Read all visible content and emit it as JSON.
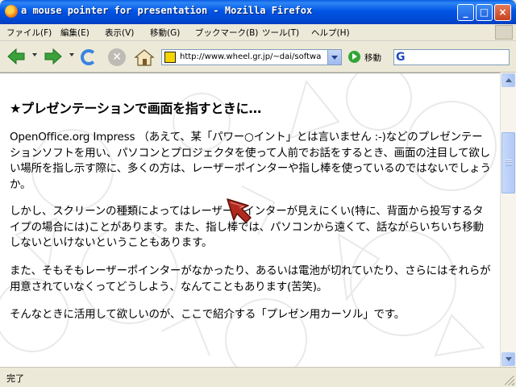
{
  "window": {
    "title": "a mouse pointer for presentation - Mozilla Firefox",
    "minimize_label": "_",
    "maximize_label": "□",
    "close_label": "×"
  },
  "menu": {
    "items": [
      "ファイル(F)",
      "編集(E)",
      "表示(V)",
      "移動(G)",
      "ブックマーク(B)",
      "ツール(T)",
      "ヘルプ(H)"
    ]
  },
  "toolbar": {
    "url": "http://www.wheel.gr.jp/~dai/softwa",
    "go_label": "移動",
    "search_engine_glyph": "G",
    "search_value": ""
  },
  "content": {
    "heading": "★プレゼンテーションで画面を指すときに…",
    "paragraphs": [
      "OpenOffice.org Impress （あえて、某「パワー○イント」とは言いません :-)などのプレゼンテーションソフトを用い、パソコンとプロジェクタを使って人前でお話をするとき、画面の注目して欲しい場所を指し示す際に、多くの方は、レーザーポインターや指し棒を使っているのではないでしょうか。",
      "しかし、スクリーンの種類によってはレーザーポインターが見えにくい(特に、背面から投写するタイプの場合には)ことがあります。また、指し棒では、パソコンから遠くて、話ながらいちいち移動しないといけないということもあります。",
      "また、そもそもレーザーポインターがなかったり、あるいは電池が切れていたり、さらにはそれらが用意されていなくってどうしよう、なんてこともあります(苦笑)。",
      "そんなときに活用して欲しいのが、ここで紹介する「プレゼン用カーソル」です。"
    ]
  },
  "status": {
    "text": "完了"
  },
  "icons": {
    "back": "back-arrow-icon",
    "forward": "forward-arrow-icon",
    "reload": "reload-icon",
    "stop": "stop-icon",
    "home": "home-icon",
    "go": "go-icon",
    "cursor": "presentation-cursor-icon"
  },
  "colors": {
    "titlebar": "#0055E5",
    "nav_green": "#3BA13B",
    "cursor_fill": "#B02A1F"
  }
}
